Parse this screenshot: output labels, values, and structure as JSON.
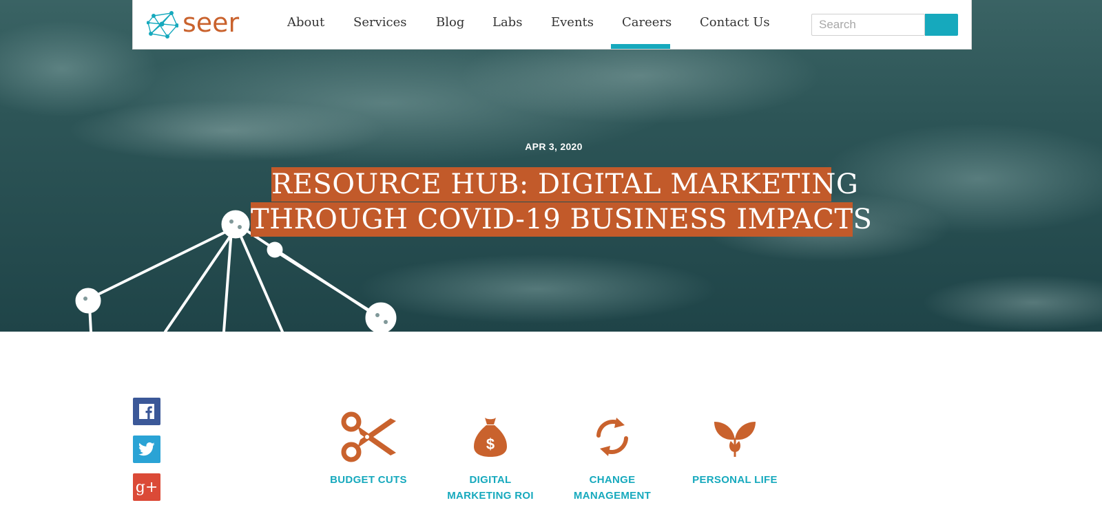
{
  "brand": {
    "name": "seer",
    "accent": "#c9622d",
    "teal": "#16a9bd"
  },
  "nav": {
    "items": [
      "About",
      "Services",
      "Blog",
      "Labs",
      "Events",
      "Careers",
      "Contact Us"
    ],
    "active": "Labs"
  },
  "search": {
    "placeholder": "Search",
    "value": ""
  },
  "hero": {
    "date": "APR 3, 2020",
    "title_line1": "RESOURCE HUB: DIGITAL MARKETING",
    "title_line2": "THROUGH COVID-19 BUSINESS IMPACTS"
  },
  "social": [
    {
      "network": "facebook",
      "icon": "facebook-icon",
      "color": "#3b5898"
    },
    {
      "network": "twitter",
      "icon": "twitter-icon",
      "color": "#2aa3d5"
    },
    {
      "network": "google-plus",
      "icon": "google-plus-icon",
      "glyph": "g+",
      "color": "#db4a37"
    }
  ],
  "categories": [
    {
      "label": "BUDGET CUTS",
      "icon": "scissors-icon"
    },
    {
      "label": "DIGITAL MARKETING ROI",
      "line1": "DIGITAL",
      "line2": "MARKETING ROI",
      "icon": "money-bag-icon"
    },
    {
      "label": "CHANGE MANAGEMENT",
      "line1": "CHANGE",
      "line2": "MANAGEMENT",
      "icon": "refresh-icon"
    },
    {
      "label": "PERSONAL LIFE",
      "icon": "sprout-icon"
    }
  ]
}
